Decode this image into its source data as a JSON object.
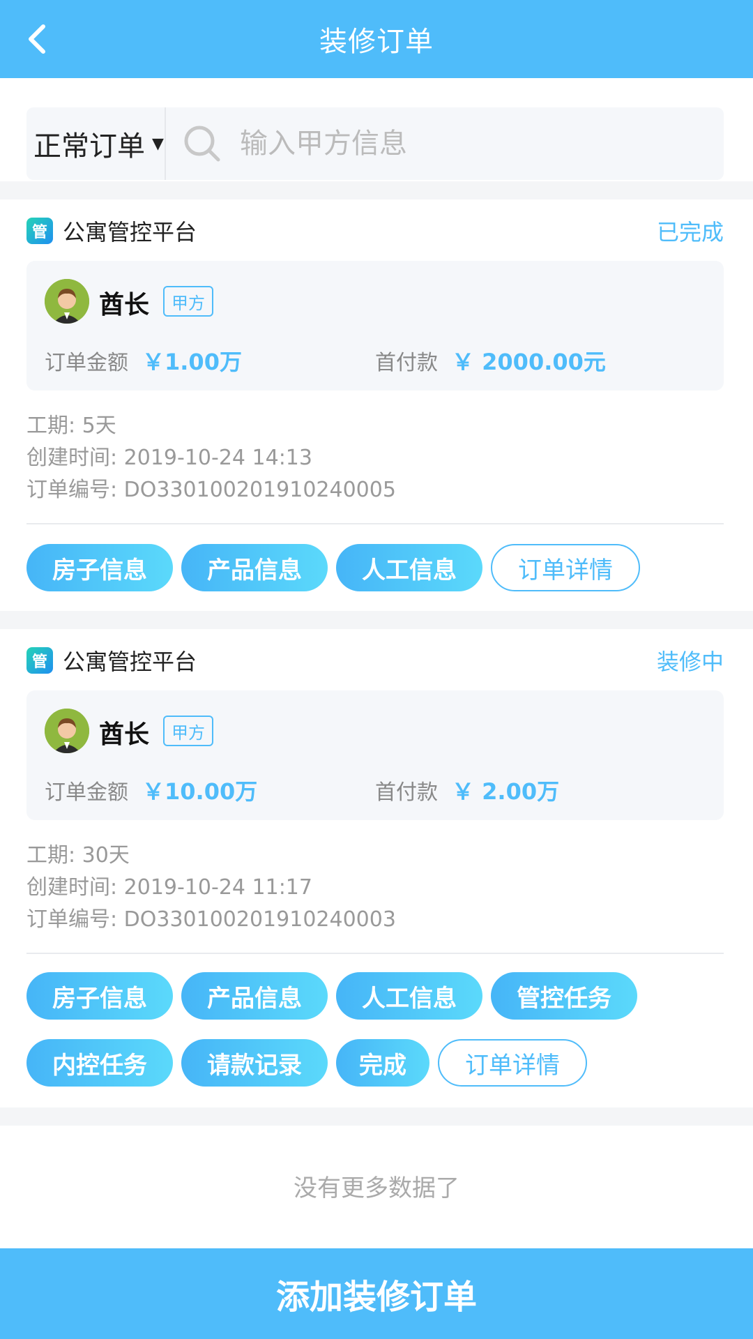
{
  "header": {
    "title": "装修订单",
    "back_icon": "chevron-left-icon"
  },
  "search": {
    "filter_label": "正常订单",
    "placeholder": "输入甲方信息"
  },
  "orders": [
    {
      "platform": "公寓管控平台",
      "platform_icon_text": "管",
      "status": "已完成",
      "person": "酋长",
      "party": "甲方",
      "amount_label": "订单金额",
      "amount": "￥1.00万",
      "down_payment_label": "首付款",
      "down_payment": "￥ 2000.00元",
      "period": "工期: 5天",
      "created": "创建时间: 2019-10-24 14:13",
      "order_no": "订单编号: DO330100201910240005",
      "actions": [
        "房子信息",
        "产品信息",
        "人工信息"
      ],
      "detail": "订单详情"
    },
    {
      "platform": "公寓管控平台",
      "platform_icon_text": "管",
      "status": "装修中",
      "person": "酋长",
      "party": "甲方",
      "amount_label": "订单金额",
      "amount": "￥10.00万",
      "down_payment_label": "首付款",
      "down_payment": "￥ 2.00万",
      "period": "工期: 30天",
      "created": "创建时间: 2019-10-24 11:17",
      "order_no": "订单编号: DO330100201910240003",
      "actions": [
        "房子信息",
        "产品信息",
        "人工信息",
        "管控任务",
        "内控任务",
        "请款记录",
        "完成"
      ],
      "detail": "订单详情"
    }
  ],
  "no_more": "没有更多数据了",
  "footer_button": "添加装修订单",
  "colors": {
    "accent": "#4fbcfa",
    "background_gray": "#f5f7fa"
  }
}
